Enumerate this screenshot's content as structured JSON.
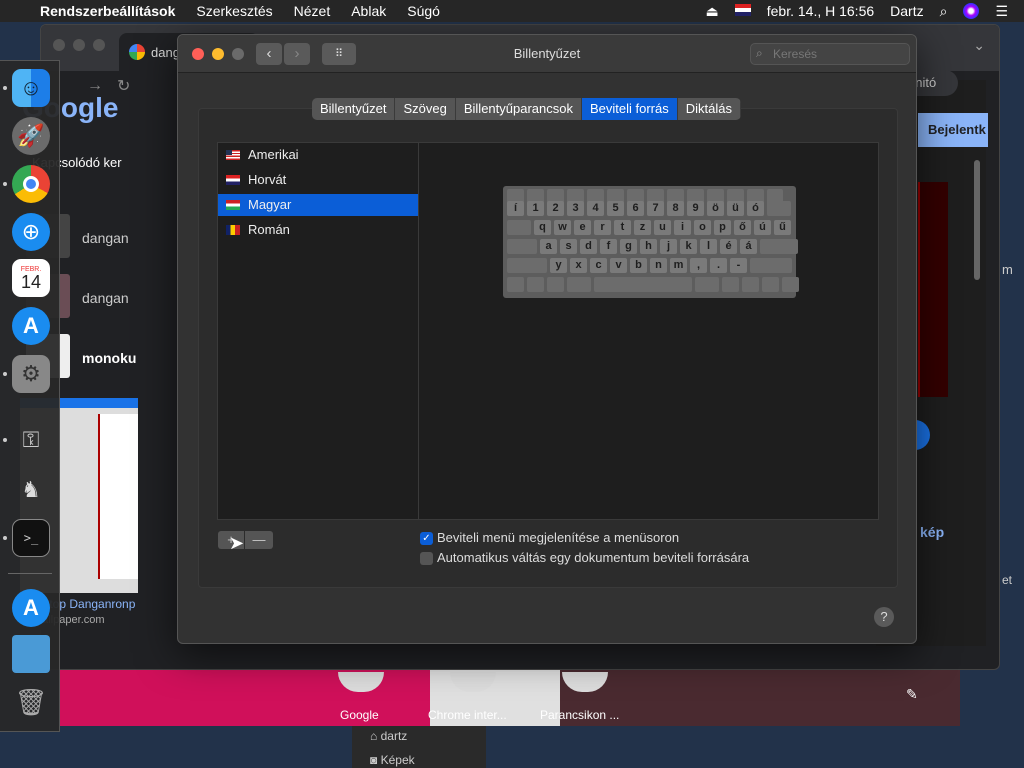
{
  "menubar": {
    "apple_icon": "",
    "app_name": "Rendszerbeállítások",
    "items": [
      "Szerkesztés",
      "Nézet",
      "Ablak",
      "Súgó"
    ],
    "datetime": "febr. 14., H 16:56",
    "user": "Dartz"
  },
  "dock": {
    "items": [
      "finder",
      "launchpad",
      "chrome",
      "safari",
      "calendar",
      "app-store",
      "system-preferences",
      "keychain",
      "chess",
      "terminal",
      "app-store-folder",
      "folder",
      "trash"
    ],
    "calendar_month": "FEBR.",
    "calendar_day": "14"
  },
  "chrome": {
    "tab_title": "dang",
    "incognito_label": "gnitó",
    "google_logo": "Google",
    "related_header": "Kapcsolódó ker",
    "results": [
      "dangan",
      "dangan",
      "monoku"
    ],
    "source_name": "Desktop Danganronp",
    "source_url": "enwallpaper.com",
    "signin_button": "Bejelentk",
    "image_link": "kép",
    "side_label_1": "m",
    "side_label_2": "et"
  },
  "shortcuts": [
    "Google",
    "Chrome inter...",
    "Parancsikon ..."
  ],
  "finder_sidebar": [
    "dartz",
    "Képek"
  ],
  "prefs": {
    "window_title": "Billentyűzet",
    "search_placeholder": "Keresés",
    "tabs": [
      "Billentyűzet",
      "Szöveg",
      "Billentyűparancsok",
      "Beviteli forrás",
      "Diktálás"
    ],
    "active_tab": "Beviteli forrás",
    "sources": [
      {
        "name": "Amerikai",
        "flag": "us"
      },
      {
        "name": "Horvát",
        "flag": "hr"
      },
      {
        "name": "Magyar",
        "flag": "hu"
      },
      {
        "name": "Román",
        "flag": "ro"
      }
    ],
    "selected_source": "Magyar",
    "keyboard_rows": [
      [
        "í",
        "1",
        "2",
        "3",
        "4",
        "5",
        "6",
        "7",
        "8",
        "9",
        "ö",
        "ü",
        "ó"
      ],
      [
        "q",
        "w",
        "e",
        "r",
        "t",
        "z",
        "u",
        "i",
        "o",
        "p",
        "ő",
        "ú",
        "ű"
      ],
      [
        "a",
        "s",
        "d",
        "f",
        "g",
        "h",
        "j",
        "k",
        "l",
        "é",
        "á"
      ],
      [
        "y",
        "x",
        "c",
        "v",
        "b",
        "n",
        "m",
        ",",
        ".",
        "-"
      ]
    ],
    "add_button": "+",
    "remove_button": "—",
    "checkbox_show_menu": "Beviteli menü megjelenítése a menüsoron",
    "checkbox_auto_switch": "Automatikus váltás egy dokumentum beviteli forrására",
    "help_button": "?"
  }
}
